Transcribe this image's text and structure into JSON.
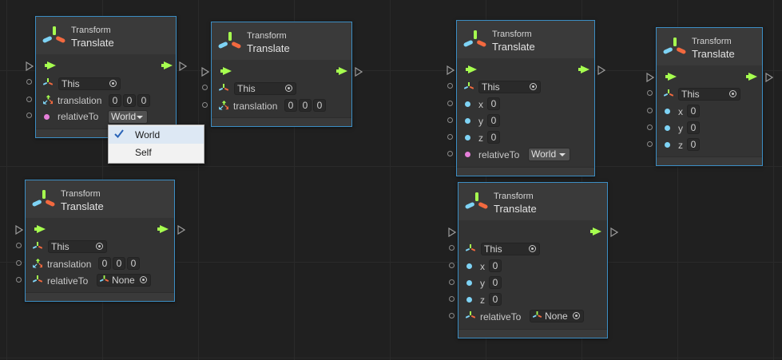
{
  "node_category": "Transform",
  "node_title": "Translate",
  "field": {
    "this_value": "This",
    "translation_label": "translation",
    "relative_to_label": "relativeTo",
    "x_label": "x",
    "y_label": "y",
    "z_label": "z",
    "zero": "0",
    "world": "World",
    "none": "None"
  },
  "popup": {
    "items": [
      {
        "label": "World",
        "checked": true
      },
      {
        "label": "Self",
        "checked": false
      }
    ]
  },
  "colors": {
    "flow": "#a6ff4f",
    "node_border": "#3c8ec4",
    "float_port": "#7ed3f5",
    "enum_port": "#e57fd9"
  }
}
